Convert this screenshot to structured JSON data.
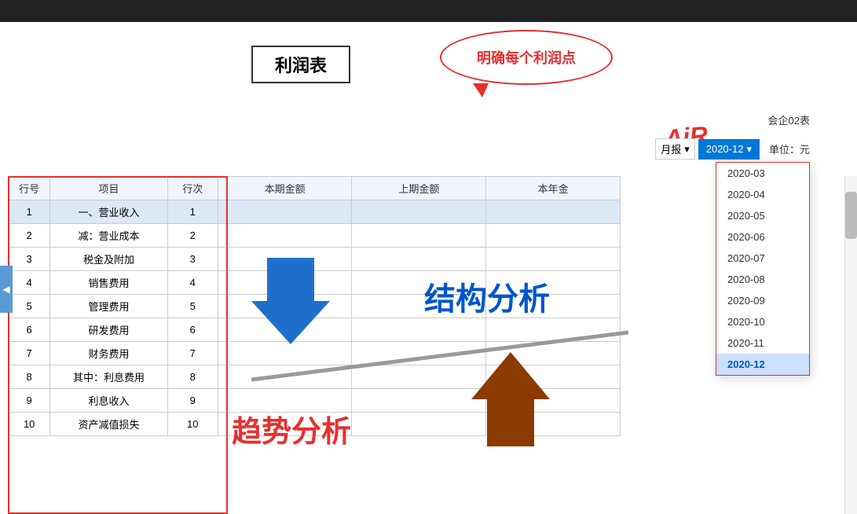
{
  "topBar": {
    "bgColor": "#222"
  },
  "title": "利润表",
  "speechBubble": {
    "text": "明确每个利润点"
  },
  "airWatermark": "AiR",
  "companyLabel": "会企02表",
  "unitLabel": "单位：元",
  "controls": {
    "reportType": "月报",
    "periodSelected": "2020-12",
    "chevronDown": "▾"
  },
  "dropdownItems": [
    "2020-03",
    "2020-04",
    "2020-05",
    "2020-06",
    "2020-07",
    "2020-08",
    "2020-09",
    "2020-10",
    "2020-11",
    "2020-12"
  ],
  "tableHeader": {
    "col1": "行号",
    "col2": "项目",
    "col3": "行次",
    "col4": "本期金额",
    "col5": "上期金额",
    "col6": "本年金"
  },
  "tableRows": [
    {
      "id": 1,
      "name": "一、营业收入",
      "seq": "1",
      "highlight": true
    },
    {
      "id": 2,
      "name": "减：营业成本",
      "seq": "2",
      "highlight": false
    },
    {
      "id": 3,
      "name": "税金及附加",
      "seq": "3",
      "highlight": false
    },
    {
      "id": 4,
      "name": "销售费用",
      "seq": "4",
      "highlight": false
    },
    {
      "id": 5,
      "name": "管理费用",
      "seq": "5",
      "highlight": false
    },
    {
      "id": 6,
      "name": "研发费用",
      "seq": "6",
      "highlight": false
    },
    {
      "id": 7,
      "name": "财务费用",
      "seq": "7",
      "highlight": false
    },
    {
      "id": 8,
      "name": "其中：利息费用",
      "seq": "8",
      "highlight": false
    },
    {
      "id": 9,
      "name": "利息收入",
      "seq": "9",
      "highlight": false
    },
    {
      "id": 10,
      "name": "资产减值损失",
      "seq": "10",
      "highlight": false
    }
  ],
  "overlays": {
    "jiegouText": "结构分析",
    "qushiText": "趋势分析"
  }
}
